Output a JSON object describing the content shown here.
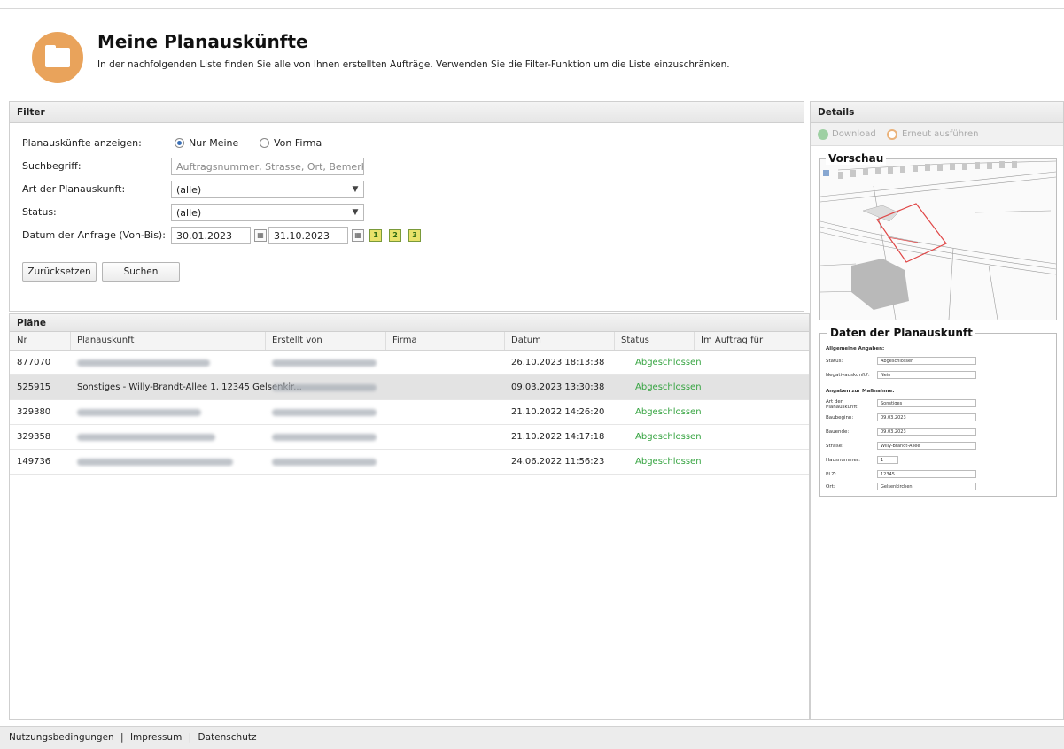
{
  "header": {
    "title": "Meine Planauskünfte",
    "subtitle": "In der nachfolgenden Liste finden Sie alle von Ihnen erstellten Aufträge. Verwenden Sie die Filter-Funktion um die Liste einzuschränken."
  },
  "filter": {
    "title": "Filter",
    "show_label": "Planauskünfte anzeigen:",
    "radio_mine": "Nur Meine",
    "radio_company": "Von Firma",
    "search_label": "Suchbegriff:",
    "search_placeholder": "Auftragsnummer, Strasse, Ort, Bemerkun",
    "type_label": "Art der Planauskunft:",
    "type_value": "(alle)",
    "status_label": "Status:",
    "status_value": "(alle)",
    "date_label": "Datum der Anfrage (Von-Bis):",
    "date_from": "30.01.2023",
    "date_to": "31.10.2023",
    "reset_button": "Zurücksetzen",
    "search_button": "Suchen"
  },
  "plans": {
    "title": "Pläne",
    "columns": [
      "Nr",
      "Planauskunft",
      "Erstellt von",
      "Firma",
      "Datum",
      "Status",
      "Im Auftrag für"
    ],
    "rows": [
      {
        "nr": "877070",
        "plan": "",
        "by": "",
        "firma": "",
        "datum": "26.10.2023 18:13:38",
        "status": "Abgeschlossen",
        "auftrag": ""
      },
      {
        "nr": "525915",
        "plan": "Sonstiges - Willy-Brandt-Allee 1, 12345 Gelsenkir...",
        "by": "",
        "firma": "",
        "datum": "09.03.2023 13:30:38",
        "status": "Abgeschlossen",
        "auftrag": ""
      },
      {
        "nr": "329380",
        "plan": "",
        "by": "",
        "firma": "",
        "datum": "21.10.2022 14:26:20",
        "status": "Abgeschlossen",
        "auftrag": ""
      },
      {
        "nr": "329358",
        "plan": "",
        "by": "",
        "firma": "",
        "datum": "21.10.2022 14:17:18",
        "status": "Abgeschlossen",
        "auftrag": ""
      },
      {
        "nr": "149736",
        "plan": "",
        "by": "",
        "firma": "",
        "datum": "24.06.2022 11:56:23",
        "status": "Abgeschlossen",
        "auftrag": ""
      }
    ]
  },
  "details": {
    "title": "Details",
    "download": "Download",
    "rerun": "Erneut ausführen",
    "preview_title": "Vorschau",
    "data_title": "Daten der Planauskunft",
    "general_heading": "Allgemeine Angaben:",
    "status_label": "Status:",
    "status_value": "Abgeschlossen",
    "negativ_label": "Negativauskunft?:",
    "negativ_value": "Nein",
    "measure_heading": "Angaben zur Maßnahme:",
    "art_label": "Art der Planauskunft:",
    "art_value": "Sonstiges",
    "baubeginn_label": "Baubeginn:",
    "baubeginn_value": "09.03.2023",
    "bauende_label": "Bauende:",
    "bauende_value": "09.03.2023",
    "strasse_label": "Straße:",
    "strasse_value": "Willy-Brandt-Allee",
    "hausnr_label": "Hausnummer:",
    "hausnr_value": "1",
    "plz_label": "PLZ:",
    "plz_value": "12345",
    "ort_label": "Ort:",
    "ort_value": "Gelsenkirchen"
  },
  "footer": {
    "terms": "Nutzungsbedingungen",
    "imprint": "Impressum",
    "privacy": "Datenschutz",
    "separator": "|"
  },
  "colors": {
    "accent_orange": "#e9a35b",
    "status_green": "#36a441",
    "selected_row": "#e3e3e3"
  },
  "icons": [
    "folder-icon",
    "calendar-icon",
    "download-icon",
    "rerun-icon",
    "date-shortcut-icon",
    "dropdown-arrow-icon"
  ]
}
